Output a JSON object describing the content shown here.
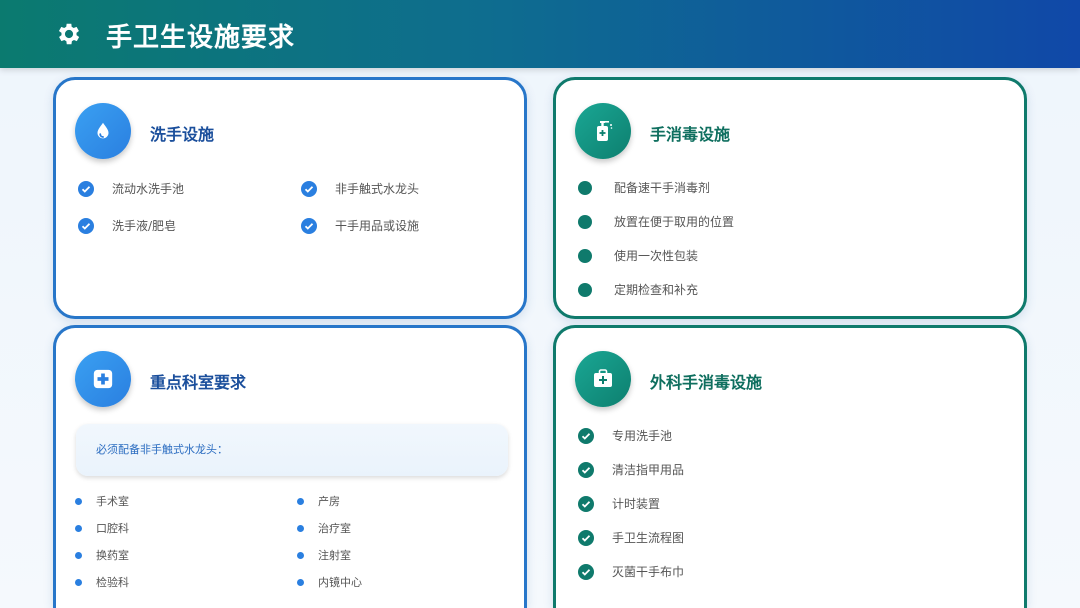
{
  "header": {
    "title": "手卫生设施要求",
    "icon": "gear-icon"
  },
  "cards": {
    "wash": {
      "title": "洗手设施",
      "icon": "water-drop-icon",
      "items": [
        "流动水洗手池",
        "非手触式水龙头",
        "洗手液/肥皂",
        "干手用品或设施"
      ]
    },
    "disinfect": {
      "title": "手消毒设施",
      "icon": "sanitizer-pump-icon",
      "items": [
        "配备速干手消毒剂",
        "放置在便于取用的位置",
        "使用一次性包装",
        "定期检查和补充"
      ]
    },
    "dept": {
      "title": "重点科室要求",
      "icon": "medical-cross-icon",
      "note": "必须配备非手触式水龙头：",
      "items": [
        "手术室",
        "产房",
        "口腔科",
        "治疗室",
        "换药室",
        "注射室",
        "检验科",
        "内镜中心"
      ]
    },
    "surgical": {
      "title": "外科手消毒设施",
      "icon": "first-aid-kit-icon",
      "items": [
        "专用洗手池",
        "清洁指甲用品",
        "计时装置",
        "手卫生流程图",
        "灭菌干手布巾"
      ]
    }
  },
  "colors": {
    "blue": "#2776c9",
    "green": "#0f7a6c"
  }
}
